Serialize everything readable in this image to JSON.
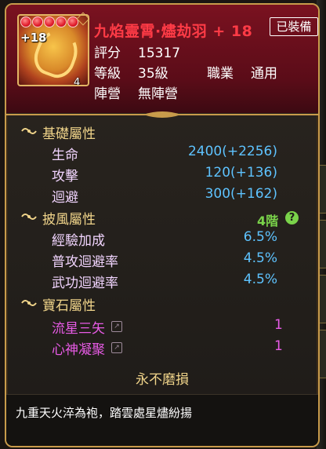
{
  "item": {
    "title": "九焰霊霄·燼劫羽 + 18",
    "equipped_label": "已裝備",
    "refine": "+18",
    "tier": "4階",
    "star_count": 5
  },
  "info": {
    "score_label": "評分",
    "score_value": "15317",
    "level_label": "等級",
    "level_value": "35級",
    "class_label": "職業",
    "class_value": "通用",
    "camp_label": "陣營",
    "camp_value": "無陣營"
  },
  "sections": {
    "base": {
      "title": "基礎屬性",
      "stats": [
        {
          "label": "生命",
          "value": "2400(+2256)"
        },
        {
          "label": "攻擊",
          "value": "120(+136)"
        },
        {
          "label": "迴避",
          "value": "300(+162)"
        }
      ]
    },
    "cape": {
      "title": "披風屬性",
      "tier": "4階",
      "help": "?",
      "stats": [
        {
          "label": "經驗加成",
          "value": "6.5%"
        },
        {
          "label": "普攻迴避率",
          "value": "4.5%"
        },
        {
          "label": "武功迴避率",
          "value": "4.5%"
        }
      ]
    },
    "gem": {
      "title": "寶石屬性",
      "stats": [
        {
          "label": "流星三矢",
          "value": "1"
        },
        {
          "label": "心神凝聚",
          "value": "1"
        }
      ]
    }
  },
  "durability": "永不磨損",
  "description": "九重天火淬為袍，踏雲處星燼紛揚",
  "colors": {
    "title_red": "#ff3b46",
    "section_gold": "#f0d48a",
    "value_blue": "#5ec3ff",
    "tier_green": "#7ad34a",
    "gem_magenta": "#e85be6"
  }
}
